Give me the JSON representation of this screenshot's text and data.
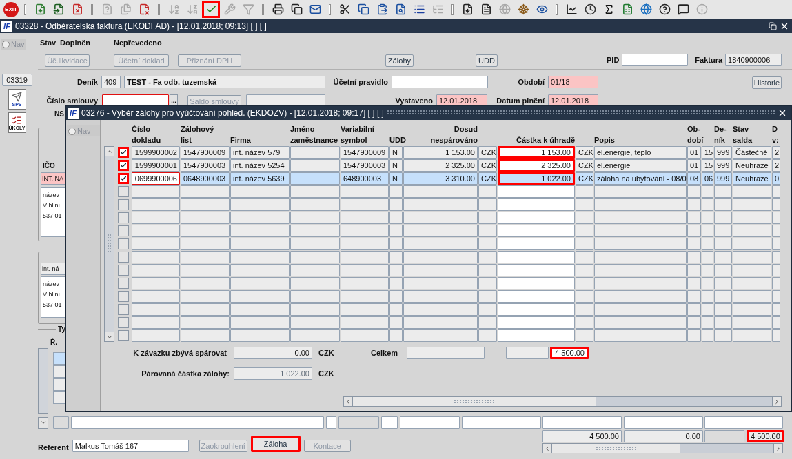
{
  "toolbar": [
    {
      "kind": "exit",
      "label": "EXIT",
      "disabled": false,
      "highlighted": false
    },
    {
      "kind": "separator"
    },
    {
      "kind": "button",
      "disabled": false,
      "highlighted": false
    },
    {
      "kind": "button",
      "disabled": false,
      "highlighted": false
    },
    {
      "kind": "button",
      "disabled": false,
      "highlighted": false
    },
    {
      "kind": "separator"
    },
    {
      "kind": "button",
      "disabled": true,
      "highlighted": false
    },
    {
      "kind": "button",
      "disabled": true,
      "highlighted": false
    },
    {
      "kind": "button",
      "disabled": false,
      "highlighted": false
    },
    {
      "kind": "separator"
    },
    {
      "kind": "button",
      "disabled": true,
      "highlighted": false
    },
    {
      "kind": "button",
      "disabled": true,
      "highlighted": false
    },
    {
      "kind": "button",
      "disabled": false,
      "highlighted": true
    },
    {
      "kind": "button",
      "disabled": true,
      "highlighted": false
    },
    {
      "kind": "button",
      "disabled": true,
      "highlighted": false
    },
    {
      "kind": "separator"
    },
    {
      "kind": "button",
      "disabled": false,
      "highlighted": false
    },
    {
      "kind": "button",
      "disabled": false,
      "highlighted": false
    },
    {
      "kind": "button",
      "disabled": false,
      "highlighted": false
    },
    {
      "kind": "separator"
    },
    {
      "kind": "button",
      "disabled": false,
      "highlighted": false
    },
    {
      "kind": "button",
      "disabled": false,
      "highlighted": false
    },
    {
      "kind": "button",
      "disabled": false,
      "highlighted": false
    },
    {
      "kind": "button",
      "disabled": false,
      "highlighted": false
    },
    {
      "kind": "button",
      "disabled": false,
      "highlighted": false
    },
    {
      "kind": "button",
      "disabled": true,
      "highlighted": false
    },
    {
      "kind": "separator"
    },
    {
      "kind": "button",
      "disabled": false,
      "highlighted": false
    },
    {
      "kind": "button",
      "disabled": false,
      "highlighted": false
    },
    {
      "kind": "button",
      "disabled": true,
      "highlighted": false
    },
    {
      "kind": "button",
      "disabled": false,
      "highlighted": false
    },
    {
      "kind": "button",
      "disabled": false,
      "highlighted": false
    },
    {
      "kind": "separator"
    },
    {
      "kind": "button",
      "disabled": false,
      "highlighted": false
    },
    {
      "kind": "button",
      "disabled": false,
      "highlighted": false
    },
    {
      "kind": "button",
      "disabled": false,
      "highlighted": false
    },
    {
      "kind": "button",
      "disabled": false,
      "highlighted": false
    },
    {
      "kind": "button",
      "disabled": false,
      "highlighted": false
    },
    {
      "kind": "button",
      "disabled": false,
      "highlighted": false
    },
    {
      "kind": "button",
      "disabled": false,
      "highlighted": false
    },
    {
      "kind": "button",
      "disabled": true,
      "highlighted": false
    }
  ],
  "main_window": {
    "logo": "IF",
    "title": "03328 - Odběratelská faktura (EKODFAD) - [12.01.2018; 09:13]  [ ]  [ ]"
  },
  "nav": {
    "label": "Nav",
    "selected": false
  },
  "side_buttons": [
    {
      "kind": "text",
      "label": "03319"
    },
    {
      "kind": "sps",
      "label": "SPS"
    },
    {
      "kind": "tasks",
      "label": "ÚKOLY"
    }
  ],
  "status": {
    "label": "Stav",
    "value": "Doplněn",
    "transfer": "Nepřevedeno"
  },
  "top_buttons": [
    {
      "label": "Úč.likvidace",
      "disabled": true
    },
    {
      "label": "Účetní doklad",
      "disabled": true
    },
    {
      "label": "Přiznání DPH",
      "disabled": true
    },
    {
      "label": "Zálohy",
      "disabled": false
    },
    {
      "label": "UDD",
      "disabled": false
    }
  ],
  "pid": {
    "label": "PID"
  },
  "invoice": {
    "label": "Faktura",
    "value": "1840900006"
  },
  "journal": {
    "label": "Deník",
    "code": "409",
    "name": "TEST - Fa odb. tuzemská"
  },
  "accounting_rule": {
    "label": "Účetní pravidlo"
  },
  "period": {
    "label": "Období",
    "value": "01/18",
    "required": true
  },
  "history_button": "Historie",
  "contract": {
    "label": "Číslo smlouvy",
    "invalid": true,
    "lookup": "...",
    "saldo_button": {
      "label": "Saldo smlouvy",
      "disabled": true
    }
  },
  "issued": {
    "label": "Vystaveno",
    "value": "12.01.2018",
    "required": true
  },
  "fulfilment": {
    "label": "Datum plnění",
    "value": "12.01.2018",
    "required": true
  },
  "ns_label": "NS",
  "partner": {
    "ico_label": "IČO",
    "name": "INT. NA",
    "address": [
      "název",
      "V hliní",
      "537 01"
    ]
  },
  "recipient": {
    "name": "int. ná",
    "address": [
      "název",
      "V hliní",
      "537 01"
    ]
  },
  "type_label": "Ty",
  "row_label": "Ř.",
  "dialog": {
    "logo": "IF",
    "title": "03276 - Výběr zálohy pro vyúčtování pohled. (EKDOZV) - [12.01.2018; 09:17]  [ ]  [ ]",
    "nav": {
      "label": "Nav",
      "selected": false
    },
    "columns": [
      {
        "label": "Číslo\ndokladu"
      },
      {
        "label": "Zálohový\nlist"
      },
      {
        "label": "Firma"
      },
      {
        "label": "Jméno\nzaměstnance"
      },
      {
        "label": "Variabilní\nsymbol"
      },
      {
        "label": "UDD"
      },
      {
        "label": "Dosud\nnespárováno"
      },
      {},
      {
        "label": "Částka k úhradě"
      },
      {},
      {
        "label": "Popis"
      },
      {
        "label": "Ob-\ndobí"
      },
      {},
      {
        "label": "De-\nník"
      },
      {
        "label": "Stav\nsalda"
      },
      {
        "label": "D\nv:"
      }
    ],
    "rows": [
      {
        "checked": true,
        "selected": false,
        "focused": false,
        "highlighted": true,
        "cells": [
          "1599900002",
          "1547900009",
          "int. název 579",
          null,
          "1547900009",
          "N",
          "1 153.00",
          "CZK",
          "1 153.00",
          "CZK",
          "el.energie, teplo",
          "01",
          "15",
          "999",
          "Částečně",
          "2"
        ]
      },
      {
        "checked": true,
        "selected": false,
        "focused": false,
        "highlighted": true,
        "cells": [
          "1599900001",
          "1547900003",
          "int. název 5254",
          null,
          "1547900003",
          "N",
          "2 325.00",
          "CZK",
          "2 325.00",
          "CZK",
          "el.energie",
          "01",
          "15",
          "999",
          "Neuhraze",
          "2"
        ]
      },
      {
        "checked": true,
        "selected": true,
        "focused": true,
        "highlighted": true,
        "cells": [
          "0699900006",
          "0648900003",
          "int. název 5639",
          null,
          "648900003",
          "N",
          "3 310.00",
          "CZK",
          "1 022.00",
          "CZK",
          "záloha na ubytování - 08/0",
          "08",
          "06",
          "999",
          "Neuhraze",
          "0"
        ]
      },
      {
        "checked": false,
        "selected": false,
        "focused": false,
        "highlighted": false
      },
      {
        "checked": false,
        "selected": false,
        "focused": false,
        "highlighted": false
      },
      {
        "checked": false,
        "selected": false,
        "focused": false,
        "highlighted": false
      },
      {
        "checked": false,
        "selected": false,
        "focused": false,
        "highlighted": false
      },
      {
        "checked": false,
        "selected": false,
        "focused": false,
        "highlighted": false
      },
      {
        "checked": false,
        "selected": false,
        "focused": false,
        "highlighted": false
      },
      {
        "checked": false,
        "selected": false,
        "focused": false,
        "highlighted": false
      },
      {
        "checked": false,
        "selected": false,
        "focused": false,
        "highlighted": false
      },
      {
        "checked": false,
        "selected": false,
        "focused": false,
        "highlighted": false
      },
      {
        "checked": false,
        "selected": false,
        "focused": false,
        "highlighted": false
      },
      {
        "checked": false,
        "selected": false,
        "focused": false,
        "highlighted": false
      },
      {
        "checked": false,
        "selected": false,
        "focused": false,
        "highlighted": false
      }
    ],
    "remaining": {
      "label": "K závazku zbývá spárovat",
      "value": "0.00",
      "currency": "CZK"
    },
    "paired": {
      "label": "Párovaná částka zálohy:",
      "value": "1 022.00",
      "currency": "CZK"
    },
    "total": {
      "label": "Celkem",
      "value": "4 500.00",
      "highlighted": true
    }
  },
  "bottom_totals": [
    {
      "value": "4 500.00",
      "highlighted": false
    },
    {
      "value": "0.00",
      "highlighted": false
    },
    {
      "value": "4 500.00",
      "highlighted": true
    }
  ],
  "referent": {
    "label": "Referent",
    "value": "Malkus Tomáš 167"
  },
  "bottom_buttons": [
    {
      "label": "Zaokrouhlení",
      "disabled": true,
      "highlighted": false
    },
    {
      "label": "Záloha",
      "disabled": false,
      "highlighted": true
    },
    {
      "label": "Kontace",
      "disabled": true,
      "highlighted": false
    }
  ]
}
